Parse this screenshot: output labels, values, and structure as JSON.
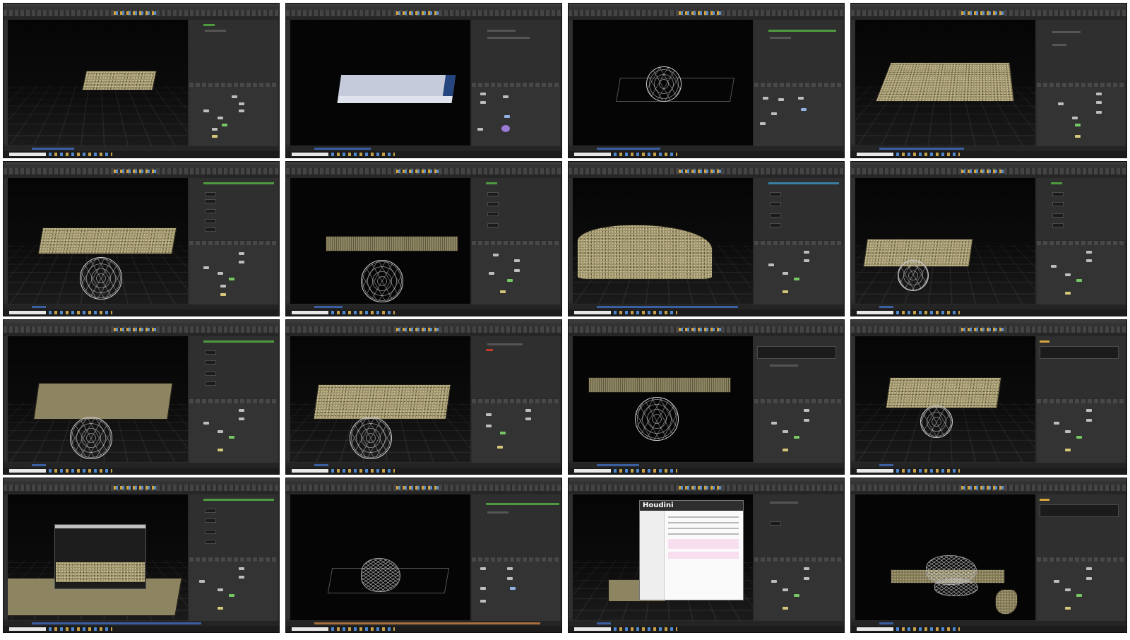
{
  "sheet": {
    "frames": [
      {
        "id": "f01",
        "description_slot": ""
      },
      {
        "id": "f02",
        "description_slot": ""
      },
      {
        "id": "f03",
        "description_slot": ""
      },
      {
        "id": "f04",
        "description_slot": ""
      },
      {
        "id": "f05",
        "description_slot": ""
      },
      {
        "id": "f06",
        "description_slot": ""
      },
      {
        "id": "f07",
        "description_slot": ""
      },
      {
        "id": "f08",
        "description_slot": ""
      },
      {
        "id": "f09",
        "description_slot": ""
      },
      {
        "id": "f10",
        "description_slot": ""
      },
      {
        "id": "f11",
        "description_slot": ""
      },
      {
        "id": "f12",
        "description_slot": ""
      },
      {
        "id": "f13",
        "description_slot": ""
      },
      {
        "id": "f14",
        "description_slot": ""
      },
      {
        "id": "f15",
        "description_slot": ""
      },
      {
        "id": "f16",
        "description_slot": ""
      }
    ]
  },
  "help_dialog": {
    "brand": "Houdini"
  },
  "colors": {
    "window_bg": "#2b2b2b",
    "viewport_bg": "#0b0b0b",
    "grain": "#9d936a",
    "node_selected": "#76c763",
    "timeline_fill": "#3b5fa3",
    "blue_box": "#c6cbdb"
  },
  "icons": {
    "node": "node-icon",
    "search": "search-icon"
  }
}
